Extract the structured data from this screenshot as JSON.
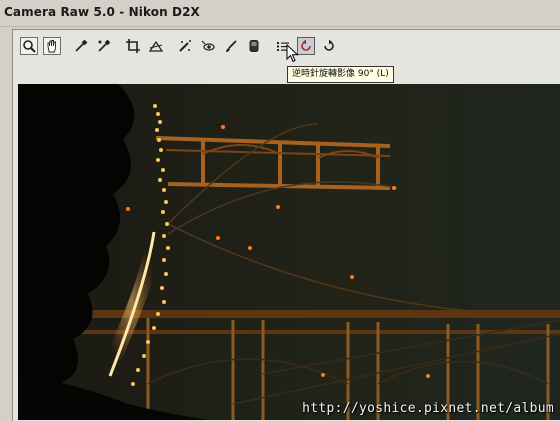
{
  "window": {
    "title": "Camera Raw 5.0  -  Nikon D2X"
  },
  "toolbar": {
    "tools": [
      {
        "name": "zoom-tool",
        "icon": "magnifier-icon"
      },
      {
        "name": "hand-tool",
        "icon": "hand-icon"
      },
      {
        "name": "white-balance-tool",
        "icon": "eyedropper-icon"
      },
      {
        "name": "color-sampler-tool",
        "icon": "color-sampler-icon"
      },
      {
        "name": "crop-tool",
        "icon": "crop-icon"
      },
      {
        "name": "straighten-tool",
        "icon": "straighten-icon"
      },
      {
        "name": "spot-removal-tool",
        "icon": "spot-removal-icon"
      },
      {
        "name": "red-eye-tool",
        "icon": "red-eye-icon"
      },
      {
        "name": "adjustment-brush-tool",
        "icon": "brush-icon"
      },
      {
        "name": "graduated-filter-tool",
        "icon": "graduated-filter-icon"
      },
      {
        "name": "preferences-tool",
        "icon": "list-icon"
      },
      {
        "name": "rotate-ccw-tool",
        "icon": "rotate-ccw-icon",
        "active": true
      },
      {
        "name": "rotate-cw-tool",
        "icon": "rotate-cw-icon"
      }
    ],
    "tooltip": "逆時針旋轉影像 90° (L)"
  },
  "preview": {
    "watermark": "http://yoshice.pixnet.net/album"
  },
  "colors": {
    "chrome": "#d4d0c8",
    "panel": "#e6e4df",
    "bridge_light": "#ff9a2a",
    "tooltip_bg": "#ffffe1"
  }
}
